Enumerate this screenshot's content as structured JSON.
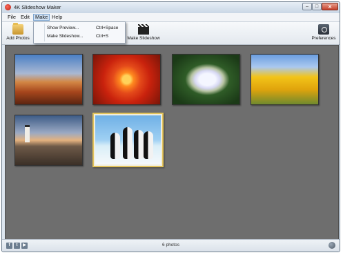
{
  "window": {
    "title": "4K Slideshow Maker",
    "controls": {
      "minimize": "–",
      "maximize": "□",
      "close": "✕"
    }
  },
  "menubar": {
    "items": [
      {
        "label": "File"
      },
      {
        "label": "Edit"
      },
      {
        "label": "Make",
        "active": true
      },
      {
        "label": "Help"
      }
    ]
  },
  "make_menu": {
    "items": [
      {
        "label": "Show Preview...",
        "shortcut": "Ctrl+Space"
      },
      {
        "label": "Make Slideshow...",
        "shortcut": "Ctrl+S"
      }
    ]
  },
  "toolbar": {
    "add_photos_label": "Add Photos",
    "make_slideshow_label": "Make Slideshow",
    "preferences_label": "Preferences",
    "add_photos_icon": "folder-icon",
    "make_slideshow_icon": "clapperboard-icon",
    "preferences_icon": "preferences-icon"
  },
  "photos": [
    {
      "name": "desert",
      "selected": false
    },
    {
      "name": "chrysanthemum",
      "selected": false
    },
    {
      "name": "hydrangeas",
      "selected": false
    },
    {
      "name": "tulips",
      "selected": false
    },
    {
      "name": "lighthouse",
      "selected": false
    },
    {
      "name": "penguins",
      "selected": true
    }
  ],
  "statusbar": {
    "photo_count_text": "6 photos",
    "social_icons": [
      "facebook-icon",
      "twitter-icon",
      "youtube-icon"
    ],
    "right_icon": "globe-icon",
    "social_glyphs": {
      "facebook": "f",
      "twitter": "t",
      "youtube": "▶"
    }
  },
  "colors": {
    "canvas_bg": "#6e6e6e",
    "selection_border": "#e2c35c",
    "menu_highlight": "#cfe0f3"
  }
}
